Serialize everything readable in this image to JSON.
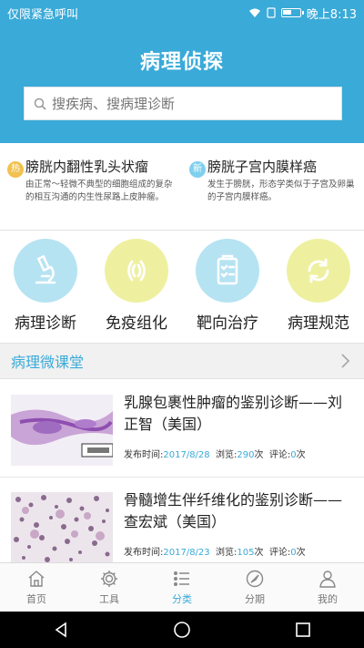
{
  "status": {
    "carrier": "仅限紧急呼叫",
    "time": "晚上8:13",
    "battery": 0.55
  },
  "header": {
    "title": "病理侦探"
  },
  "search": {
    "placeholder": "搜疾病、搜病理诊断"
  },
  "news": [
    {
      "badge": "热",
      "badge_color": "#f2c14e",
      "title": "膀胱内翻性乳头状瘤",
      "desc": "由正常～轻微不典型的细胞组成的复杂的相互沟通的内生性尿路上皮肿瘤。"
    },
    {
      "badge": "新",
      "badge_color": "#7fd0ee",
      "title": "膀胱子宫内膜样癌",
      "desc": "发生于膀胱，形态学类似于子宫及卵巢的子宫内膜样癌。"
    }
  ],
  "categories": [
    {
      "label": "病理诊断",
      "icon": "microscope-icon",
      "color": "#b6e3f2"
    },
    {
      "label": "免疫组化",
      "icon": "antibody-icon",
      "color": "#eef0a0"
    },
    {
      "label": "靶向治疗",
      "icon": "checklist-icon",
      "color": "#b6e3f2"
    },
    {
      "label": "病理规范",
      "icon": "refresh-icon",
      "color": "#eef0a0"
    }
  ],
  "section": {
    "title": "病理微课堂"
  },
  "articles": [
    {
      "title": "乳腺包裹性肿瘤的鉴别诊断——刘正智（美国）",
      "date_label": "发布时间:",
      "date": "2017/8/28",
      "views_label": "浏览:",
      "views": "290",
      "views_unit": "次",
      "comments_label": "评论:",
      "comments": "0",
      "comments_unit": "次"
    },
    {
      "title": "骨髓增生伴纤维化的鉴别诊断——查宏斌（美国）",
      "date_label": "发布时间:",
      "date": "2017/8/23",
      "views_label": "浏览:",
      "views": "105",
      "views_unit": "次",
      "comments_label": "评论:",
      "comments": "0",
      "comments_unit": "次"
    }
  ],
  "tabs": [
    {
      "label": "首页",
      "icon": "home-icon"
    },
    {
      "label": "工具",
      "icon": "gear-icon"
    },
    {
      "label": "分类",
      "icon": "list-icon"
    },
    {
      "label": "分期",
      "icon": "compass-icon"
    },
    {
      "label": "我的",
      "icon": "user-icon"
    }
  ],
  "colors": {
    "accent": "#3aaad8",
    "text": "#222222"
  }
}
